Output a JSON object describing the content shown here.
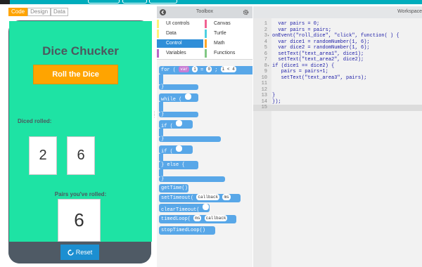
{
  "modes": [
    "Code",
    "Design",
    "Data"
  ],
  "app": {
    "title": "Dice Chucker",
    "roll_button": "Roll the Dice",
    "diced_rolled_label": "Diced rolled:",
    "die1": "2",
    "die2": "6",
    "pairs_label": "Pairs you've rolled:",
    "pairs_value": "6",
    "reset_button": "Reset"
  },
  "toolbox": {
    "title": "Toolbox",
    "categories": [
      {
        "label": "UI controls",
        "color": "#fff176"
      },
      {
        "label": "Canvas",
        "color": "#f06292"
      },
      {
        "label": "Data",
        "color": "#fff176"
      },
      {
        "label": "Turtle",
        "color": "#4dd0e1"
      },
      {
        "label": "Control",
        "color": "#2f8ed8"
      },
      {
        "label": "Math",
        "color": "#ffa726"
      },
      {
        "label": "Variables",
        "color": "#ba68c8"
      },
      {
        "label": "Functions",
        "color": "#81c784"
      }
    ],
    "blocks": {
      "for_kw": "for (",
      "for_var": "var",
      "for_i": "i",
      "for_eq": "=",
      "for_zero": "0",
      "for_sep": ";",
      "for_cond": "i < 4",
      "for_close": "}",
      "while_kw": "while (",
      "while_close": "}",
      "if_kw": "if (",
      "if_close": "}",
      "ifelse_kw": "if (",
      "else_kw": "} else {",
      "ifelse_close": "}",
      "get_time": "getTime()",
      "set_timeout": "setTimeout(",
      "set_timeout_cb": "callback",
      "set_timeout_ms": "ms",
      "clear_timeout": "clearTimeout(",
      "timed_loop": "timedLoop(",
      "timed_loop_ms": "ms",
      "timed_loop_cb": "callback",
      "stop_timed_loop": "stopTimedLoop()"
    }
  },
  "workspace": {
    "title": "Workspace",
    "code": [
      "  var pairs = 0;",
      "  var pairs = pairs;",
      "onEvent(\"roll_dice\", \"click\", function( ) {",
      "  var dice1 = randomNumber(1, 6);",
      "  var dice2 = randomNumber(1, 6);",
      "  setText(\"text_area1\", dice1);",
      "  setText(\"text_area2\", dice2);",
      "if (dice1 == dice2) {",
      "   pairs = pairs+1;",
      "   setText(\"text_area3\", pairs);",
      "",
      "",
      "}",
      "});",
      ""
    ]
  },
  "colors": {
    "screen_bg": "#1ee3a4",
    "phone_frame": "#4f5a65",
    "accent_orange": "#ffa400",
    "reset_blue": "#1c8fd1",
    "block_blue": "#58a7e8"
  }
}
